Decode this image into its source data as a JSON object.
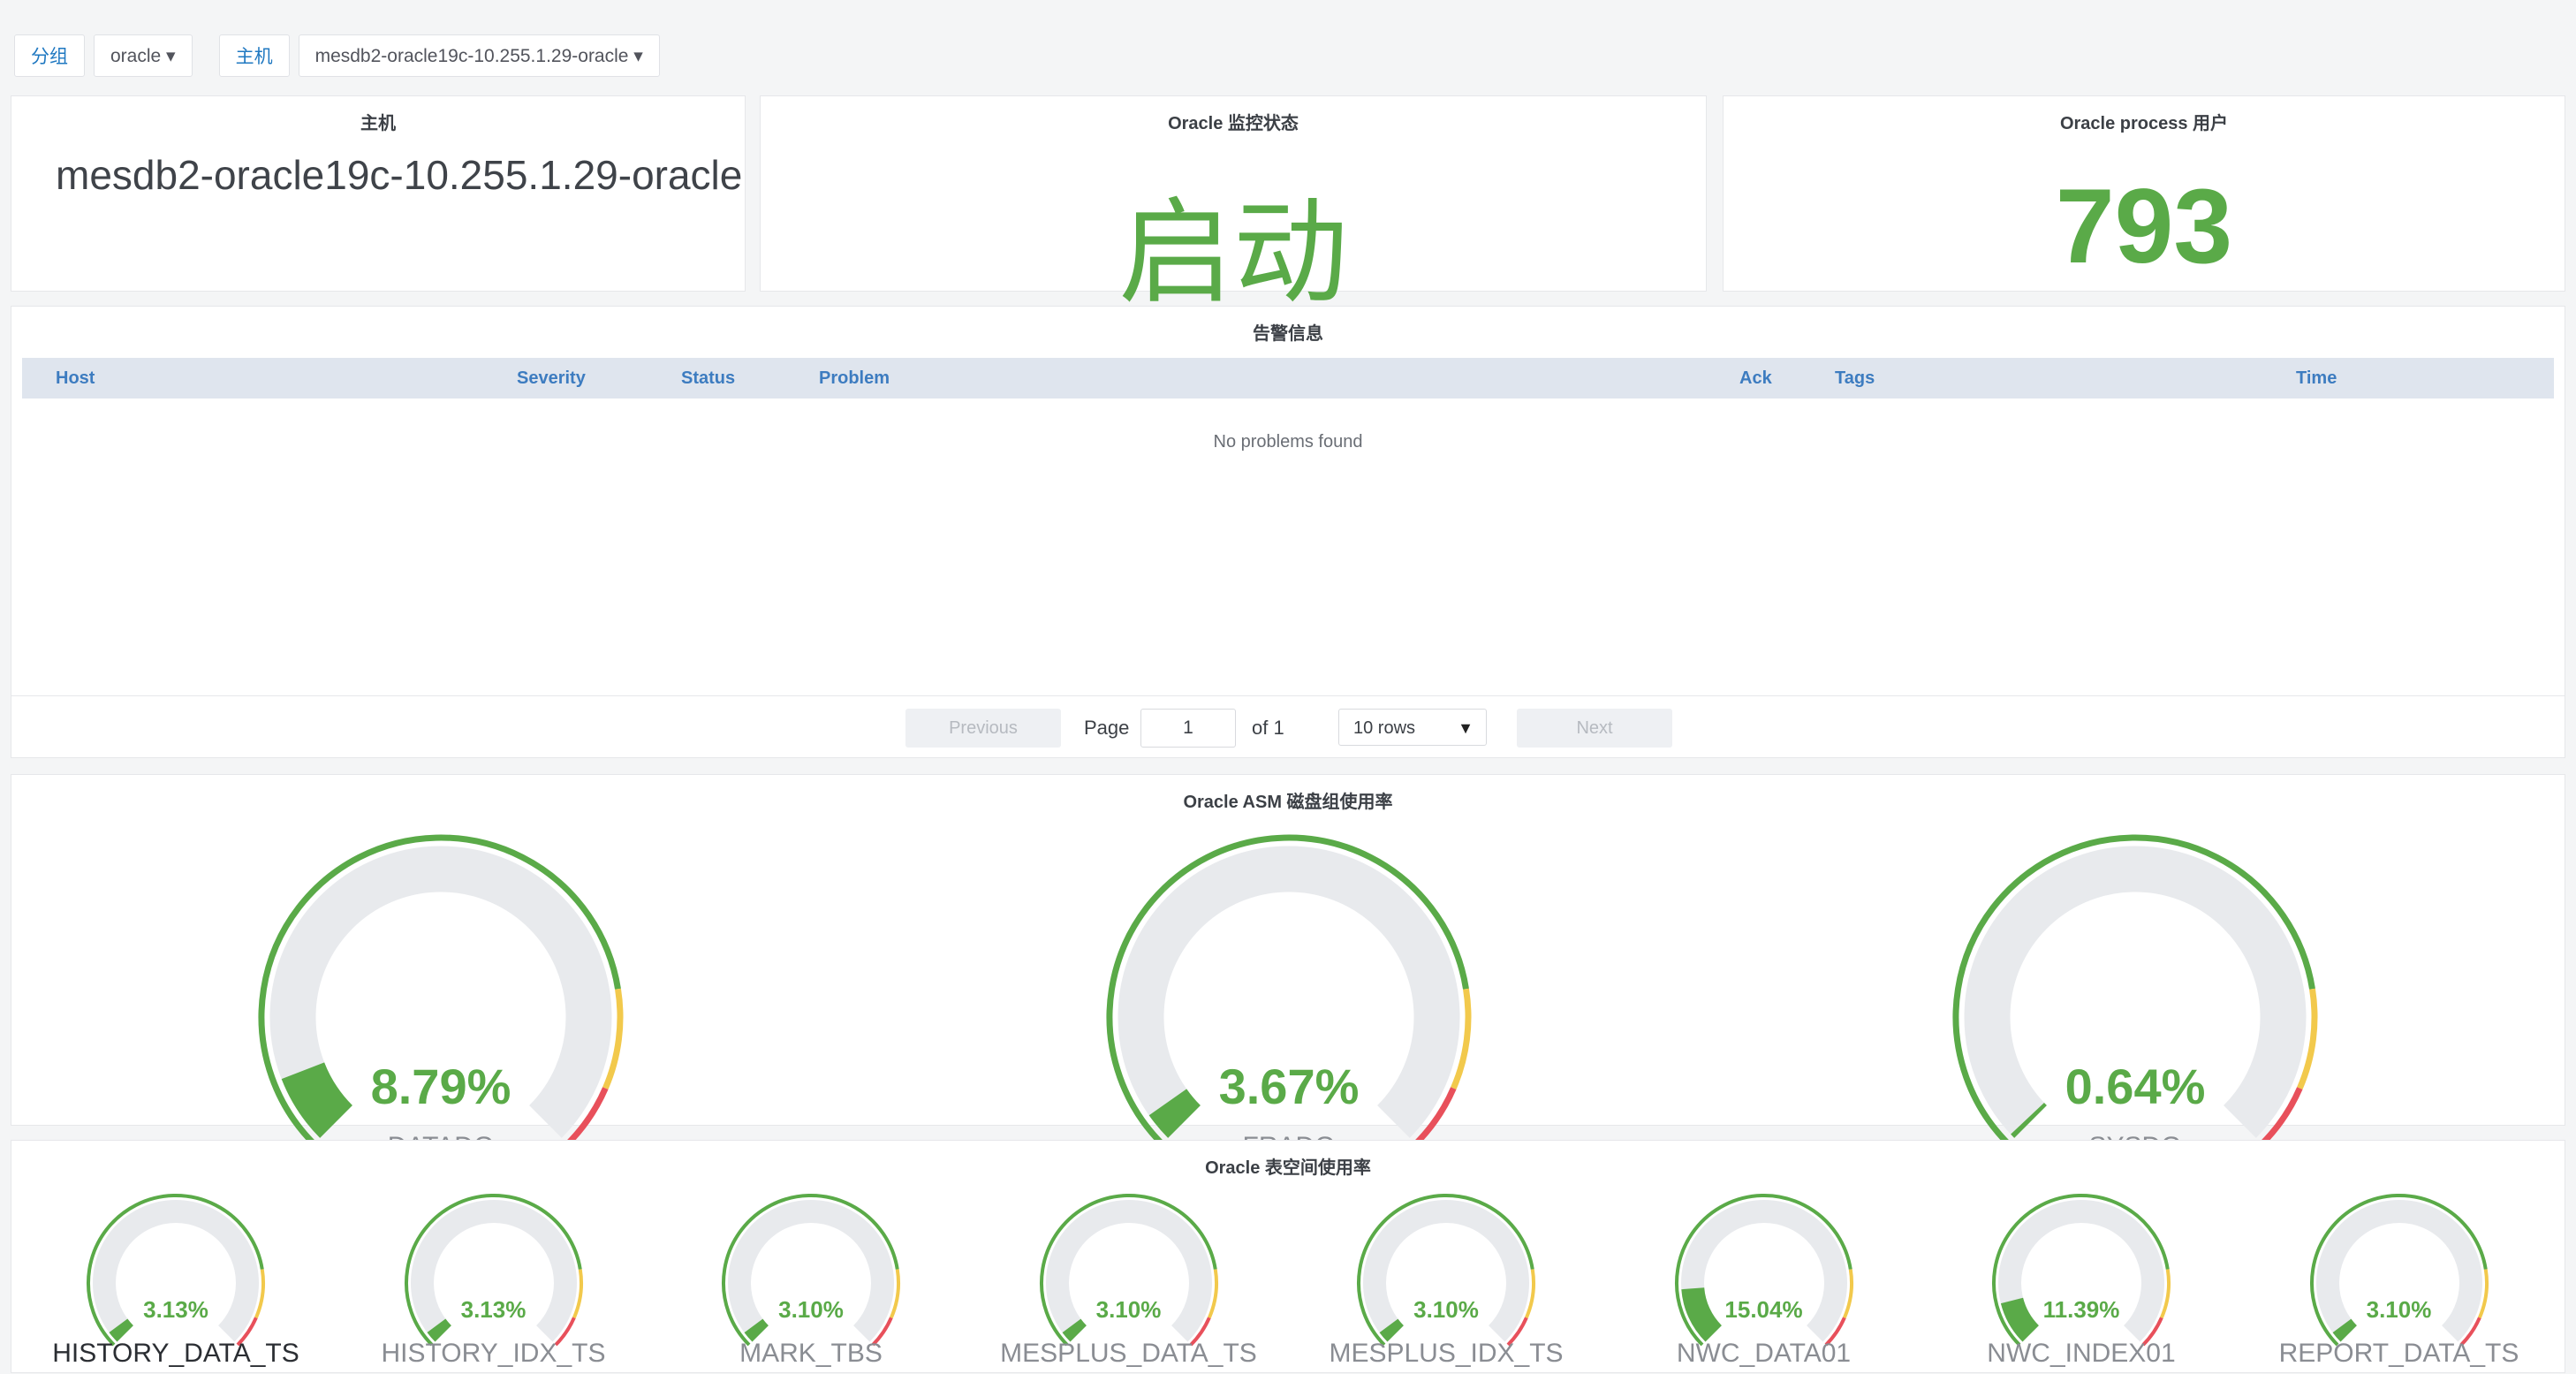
{
  "variables": {
    "group_label": "分组",
    "group_value": "oracle ▾",
    "host_label": "主机",
    "host_value": "mesdb2-oracle19c-10.255.1.29-oracle ▾"
  },
  "panels": {
    "instance": {
      "title": "主机",
      "value": "mesdb2-oracle19c-10.255.1.29-oracle"
    },
    "status": {
      "title": "Oracle 监控状态",
      "value": "启动"
    },
    "process": {
      "title": "Oracle process 用户",
      "value": "793"
    }
  },
  "problems": {
    "title": "告警信息",
    "columns": [
      "Host",
      "Severity",
      "Status",
      "Problem",
      "Ack",
      "Tags",
      "Time"
    ],
    "empty_text": "No problems found",
    "pager": {
      "previous": "Previous",
      "page_label": "Page",
      "page_value": "1",
      "of_label": "of 1",
      "rows_value": "10 rows",
      "next": "Next"
    }
  },
  "asm": {
    "title": "Oracle ASM 磁盘组使用率",
    "gauges": [
      {
        "name": "DATADG",
        "value_text": "8.79%",
        "value": 8.79
      },
      {
        "name": "FRADG",
        "value_text": "3.67%",
        "value": 3.67
      },
      {
        "name": "SYSDG",
        "value_text": "0.64%",
        "value": 0.64
      }
    ]
  },
  "tablespace": {
    "title": "Oracle 表空间使用率",
    "gauges": [
      {
        "name": "HISTORY_DATA_TS",
        "value_text": "3.13%",
        "value": 3.13
      },
      {
        "name": "HISTORY_IDX_TS",
        "value_text": "3.13%",
        "value": 3.13
      },
      {
        "name": "MARK_TBS",
        "value_text": "3.10%",
        "value": 3.1
      },
      {
        "name": "MESPLUS_DATA_TS",
        "value_text": "3.10%",
        "value": 3.1
      },
      {
        "name": "MESPLUS_IDX_TS",
        "value_text": "3.10%",
        "value": 3.1
      },
      {
        "name": "NWC_DATA01",
        "value_text": "15.04%",
        "value": 15.04
      },
      {
        "name": "NWC_INDEX01",
        "value_text": "11.39%",
        "value": 11.39
      },
      {
        "name": "REPORT_DATA_TS",
        "value_text": "3.10%",
        "value": 3.1
      }
    ]
  },
  "colors": {
    "ok": "#5aaa48",
    "warn": "#f2c94c",
    "crit": "#e8505b",
    "track": "#e8eaed"
  }
}
